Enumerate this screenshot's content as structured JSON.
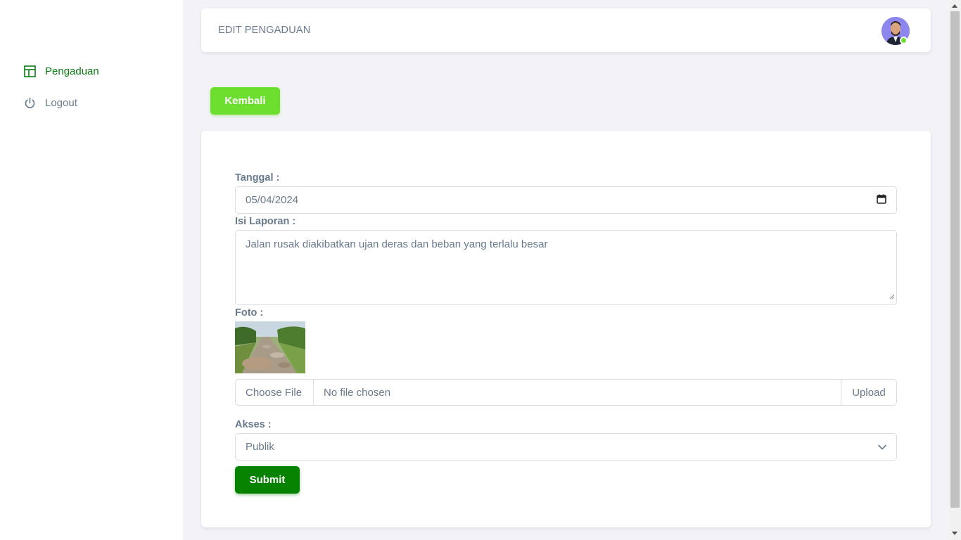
{
  "sidebar": {
    "items": [
      {
        "label": "Pengaduan",
        "icon": "layout-icon",
        "active": true
      },
      {
        "label": "Logout",
        "icon": "power-icon",
        "active": false
      }
    ]
  },
  "header": {
    "title": "EDIT PENGADUAN",
    "avatar_status_color": "#71dd37"
  },
  "actions": {
    "back_label": "Kembali"
  },
  "form": {
    "date_label": "Tanggal :",
    "date_value": "05/04/2024",
    "report_label": "Isi Laporan :",
    "report_value": "Jalan rusak diakibatkan ujan deras dan beban yang terlalu besar",
    "photo_label": "Foto :",
    "file_choose_label": "Choose File",
    "file_name": "No file chosen",
    "upload_label": "Upload",
    "access_label": "Akses :",
    "access_value": "Publik",
    "submit_label": "Submit"
  },
  "colors": {
    "accent": "#0a7d13",
    "back_button": "#6cdf2e",
    "submit_button": "#068200"
  }
}
